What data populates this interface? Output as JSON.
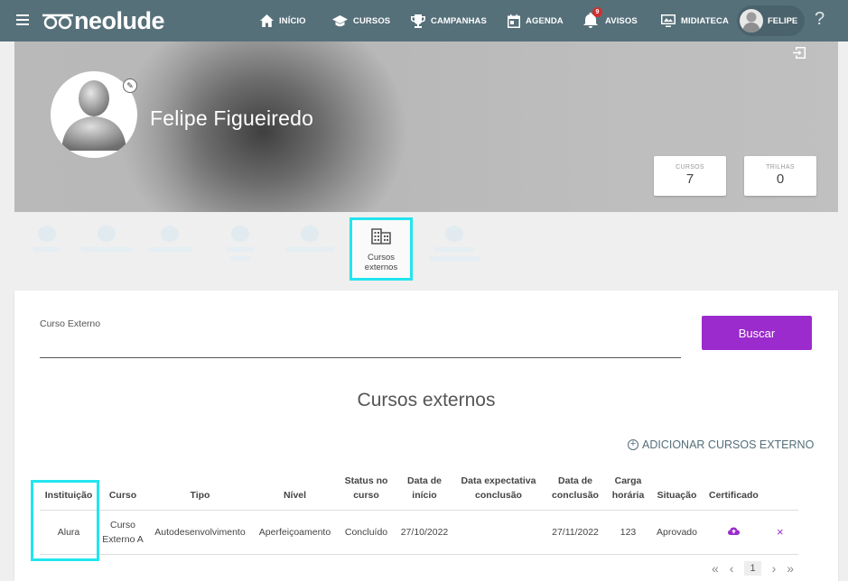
{
  "app": {
    "brand": "neolude"
  },
  "nav": {
    "items": [
      {
        "label": "INÍCIO",
        "icon": "home-icon"
      },
      {
        "label": "CURSOS",
        "icon": "graduation-cap-icon"
      },
      {
        "label": "CAMPANHAS",
        "icon": "trophy-icon"
      },
      {
        "label": "AGENDA",
        "icon": "calendar-icon"
      },
      {
        "label": "AVISOS",
        "icon": "bell-icon",
        "badge": "9"
      },
      {
        "label": "MIDIATECA",
        "icon": "media-library-icon"
      }
    ],
    "user": "FELIPE",
    "help": "?"
  },
  "profile": {
    "name": "Felipe Figueiredo",
    "stats": [
      {
        "label": "CURSOS",
        "value": "7"
      },
      {
        "label": "TRILHAS",
        "value": "0"
      }
    ]
  },
  "tabs": {
    "active": {
      "line1": "Cursos",
      "line2": "externos"
    }
  },
  "search": {
    "label": "Curso Externo",
    "value": "",
    "button": "Buscar"
  },
  "section": {
    "title": "Cursos externos",
    "add_label": "ADICIONAR CURSOS EXTERNO"
  },
  "table": {
    "headers": {
      "instituicao": "Instituição",
      "curso": "Curso",
      "tipo": "Tipo",
      "nivel": "Nível",
      "status_1": "Status no",
      "status_2": "curso",
      "inicio_1": "Data de",
      "inicio_2": "início",
      "exp_1": "Data expectativa",
      "exp_2": "conclusão",
      "conc_1": "Data de",
      "conc_2": "conclusão",
      "carga_1": "Carga",
      "carga_2": "horária",
      "situacao": "Situação",
      "certificado": "Certificado"
    },
    "rows": [
      {
        "instituicao": "Alura",
        "curso_1": "Curso",
        "curso_2": "Externo A",
        "tipo": "Autodesenvolvimento",
        "nivel": "Aperfeiçoamento",
        "status": "Concluído",
        "inicio": "27/10/2022",
        "expectativa": "",
        "conclusao": "27/11/2022",
        "carga": "123",
        "situacao": "Aprovado",
        "delete": "×"
      }
    ]
  },
  "pager": {
    "first": "«",
    "prev": "‹",
    "page": "1",
    "next": "›",
    "last": "»"
  },
  "colors": {
    "topbar": "#56707a",
    "accent": "#9b2bcc",
    "highlight": "#22e5ee"
  }
}
